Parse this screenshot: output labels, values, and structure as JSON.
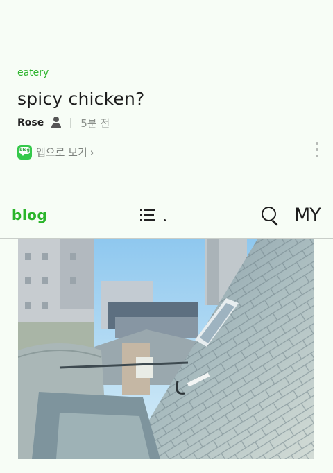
{
  "post": {
    "category": "eatery",
    "title": "spicy chicken?",
    "author": "Rose",
    "time": "5분 전",
    "app_view_label": "앱으로 보기",
    "app_view_chevron": "›",
    "app_badge_text": "blog"
  },
  "navbar": {
    "logo": "blog",
    "my_label": "MY"
  },
  "icons": [
    "person-icon",
    "blog-app-icon",
    "chevron-right-icon",
    "more-vertical-icon",
    "menu-list-icon",
    "search-icon"
  ],
  "colors": {
    "background": "#f7fdf6",
    "accent": "#2bb52b",
    "muted_text": "#8a8f8a"
  }
}
